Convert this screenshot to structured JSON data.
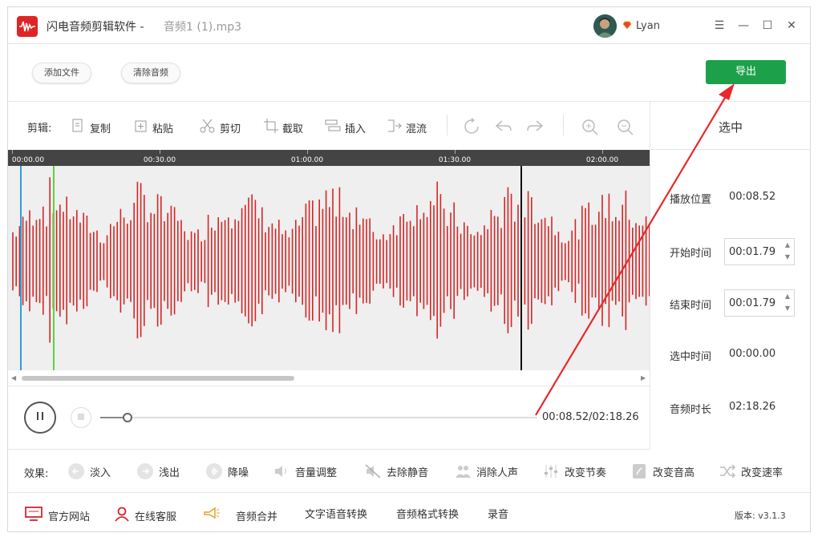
{
  "titlebar": {
    "app_name": "闪电音频剪辑软件 - ",
    "file_name": "音频1 (1).mp3",
    "user_name": "Lyan",
    "minimize": "—",
    "maximize": "☐",
    "close": "✕",
    "menu": "☰"
  },
  "top_toolbar": {
    "add_file": "添加文件",
    "clear_audio": "清除音频",
    "export": "导出"
  },
  "edit_bar": {
    "label": "剪辑:",
    "copy": "复制",
    "paste": "粘贴",
    "cut": "剪切",
    "crop": "截取",
    "insert": "插入",
    "mix": "混流"
  },
  "timeline": {
    "ticks": [
      "00:00.00",
      "00:30.00",
      "01:00.00",
      "01:30.00",
      "02:00.00"
    ]
  },
  "player": {
    "time": "00:08.52/02:18.26",
    "progress": 0.0615
  },
  "side_panel": {
    "header": "选中",
    "play_pos_label": "播放位置",
    "play_pos": "00:08.52",
    "start_label": "开始时间",
    "start": "00:01.79",
    "end_label": "结束时间",
    "end": "00:01.79",
    "selected_label": "选中时间",
    "selected": "00:00.00",
    "duration_label": "音频时长",
    "duration": "02:18.26"
  },
  "effects": {
    "label": "效果:",
    "fade_in": "淡入",
    "fade_out": "浅出",
    "denoise": "降噪",
    "volume": "音量调整",
    "remove_silence": "去除静音",
    "remove_vocal": "消除人声",
    "rhythm": "改变节奏",
    "pitch": "改变音高",
    "speed": "改变速率"
  },
  "footer": {
    "website": "官方网站",
    "service": "在线客服",
    "merge": "音频合并",
    "tts": "文字语音转换",
    "format": "音频格式转换",
    "record": "录音",
    "version": "版本: v3.1.3"
  },
  "colors": {
    "accent_green": "#1ca14a",
    "wave_red": "#d32626",
    "footer_red": "#d0282e",
    "annotation_red": "#e8282b"
  }
}
